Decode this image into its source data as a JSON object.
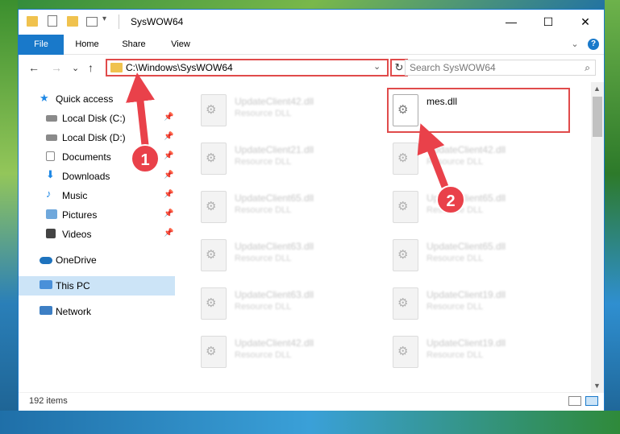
{
  "window": {
    "title": "SysWOW64",
    "controls": {
      "minimize": "—",
      "maximize": "☐",
      "close": "✕"
    }
  },
  "ribbon": {
    "tabs": [
      "File",
      "Home",
      "Share",
      "View"
    ],
    "expand": "⌄",
    "help": "?"
  },
  "navigation": {
    "back": "←",
    "forward": "→",
    "recent": "⌄",
    "up": "↑",
    "address": "C:\\Windows\\SysWOW64",
    "address_dropdown": "⌄",
    "refresh": "↻",
    "search_placeholder": "Search SysWOW64",
    "search_icon": "⌕"
  },
  "sidebar": {
    "items": [
      {
        "label": "Quick access",
        "icon": "star-icon",
        "pinned": false
      },
      {
        "label": "Local Disk (C:)",
        "icon": "drive-icon",
        "pinned": true
      },
      {
        "label": "Local Disk (D:)",
        "icon": "drive-icon",
        "pinned": true
      },
      {
        "label": "Documents",
        "icon": "documents-icon",
        "pinned": true
      },
      {
        "label": "Downloads",
        "icon": "download-icon",
        "pinned": true
      },
      {
        "label": "Music",
        "icon": "music-icon",
        "pinned": true
      },
      {
        "label": "Pictures",
        "icon": "pictures-icon",
        "pinned": true
      },
      {
        "label": "Videos",
        "icon": "videos-icon",
        "pinned": true
      },
      {
        "label": "OneDrive",
        "icon": "cloud-icon",
        "pinned": false
      },
      {
        "label": "This PC",
        "icon": "computer-icon",
        "pinned": false,
        "selected": true
      },
      {
        "label": "Network",
        "icon": "network-icon",
        "pinned": false
      }
    ]
  },
  "files": {
    "col1": [
      {
        "name": "UpdateClient42.dll",
        "type": "Resource DLL"
      },
      {
        "name": "UpdateClient21.dll",
        "type": "Resource DLL"
      },
      {
        "name": "UpdateClient65.dll",
        "type": "Resource DLL"
      },
      {
        "name": "UpdateClient63.dll",
        "type": "Resource DLL"
      },
      {
        "name": "UpdateClient63.dll",
        "type": "Resource DLL"
      },
      {
        "name": "UpdateClient42.dll",
        "type": "Resource DLL"
      }
    ],
    "col2": [
      {
        "name": "mes.dll",
        "type": ""
      },
      {
        "name": "UpdateClient42.dll",
        "type": "Resource DLL"
      },
      {
        "name": "UpdateClient65.dll",
        "type": "Resource DLL"
      },
      {
        "name": "UpdateClient65.dll",
        "type": "Resource DLL"
      },
      {
        "name": "UpdateClient19.dll",
        "type": "Resource DLL"
      },
      {
        "name": "UpdateClient19.dll",
        "type": "Resource DLL"
      }
    ]
  },
  "status": {
    "item_count": "192 items"
  },
  "annotations": {
    "step1": "1",
    "step2": "2",
    "color": "#e9414a"
  }
}
